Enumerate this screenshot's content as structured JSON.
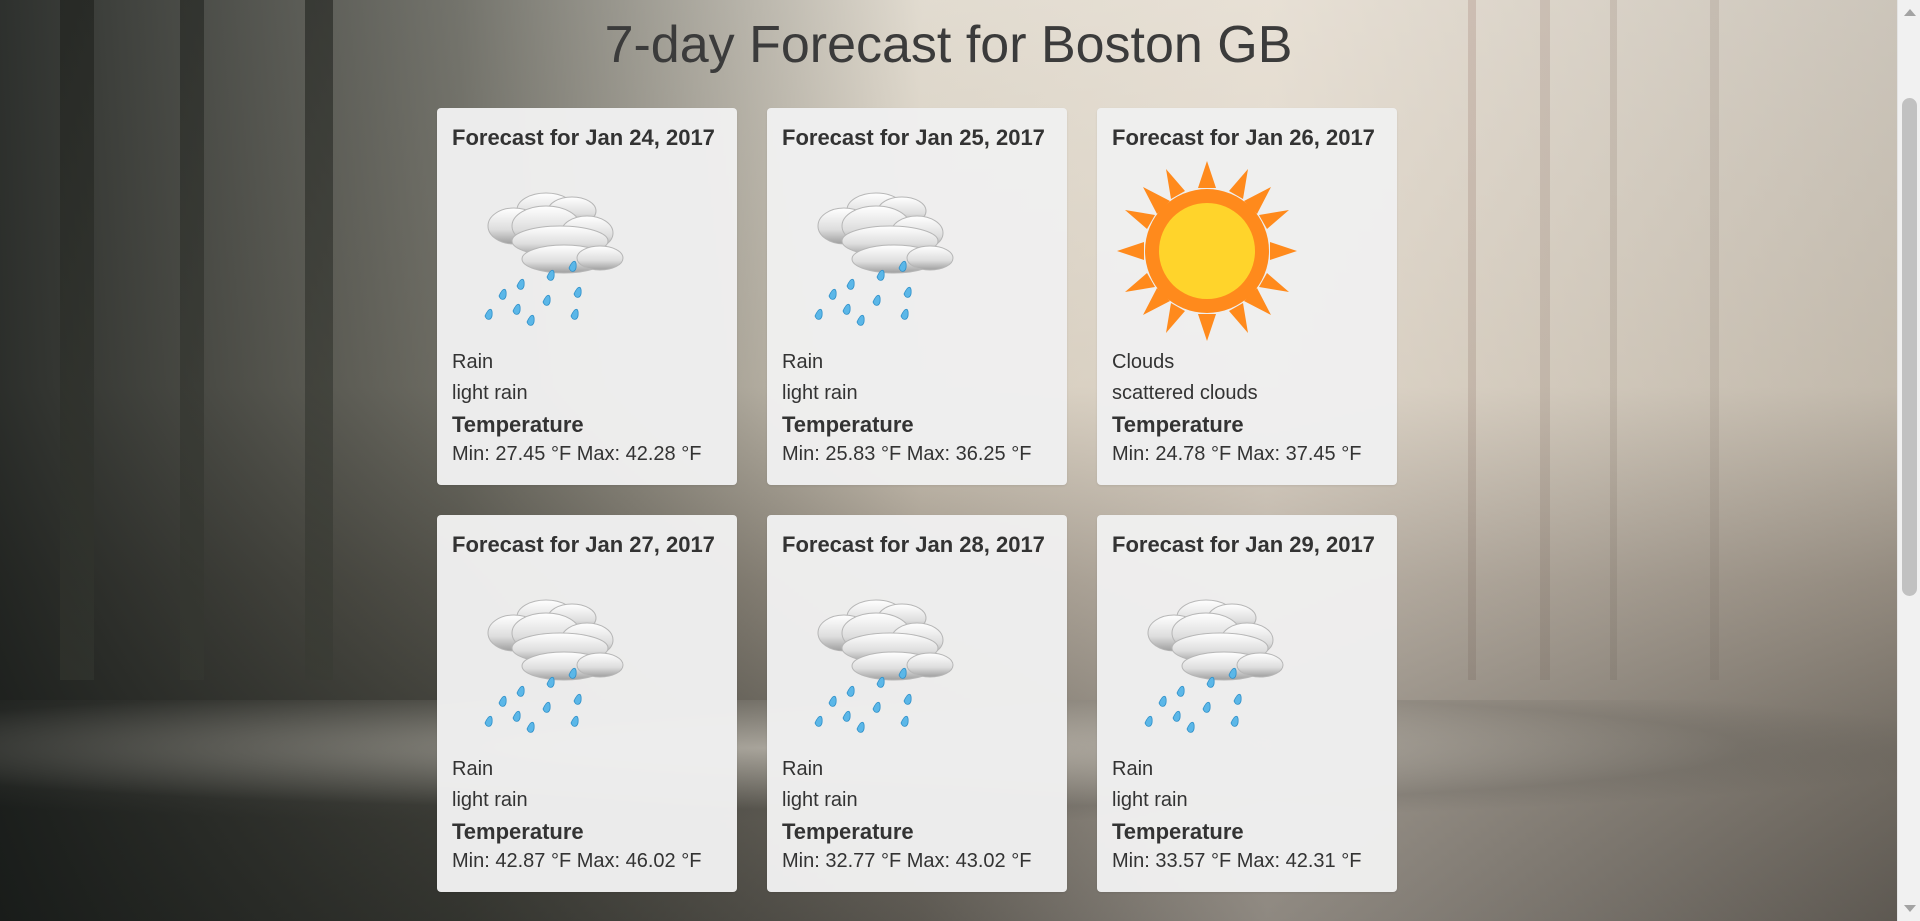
{
  "page": {
    "title": "7-day Forecast for Boston GB"
  },
  "forecast": [
    {
      "date": "Forecast for Jan 24, 2017",
      "icon": "rain-cloud-icon",
      "main": "Rain",
      "description": "light rain",
      "temperature_label": "Temperature",
      "temperature": "Min: 27.45 °F Max: 42.28 °F"
    },
    {
      "date": "Forecast for Jan 25, 2017",
      "icon": "rain-cloud-icon",
      "main": "Rain",
      "description": "light rain",
      "temperature_label": "Temperature",
      "temperature": "Min: 25.83 °F Max: 36.25 °F"
    },
    {
      "date": "Forecast for Jan 26, 2017",
      "icon": "sun-icon",
      "main": "Clouds",
      "description": "scattered clouds",
      "temperature_label": "Temperature",
      "temperature": "Min: 24.78 °F Max: 37.45 °F"
    },
    {
      "date": "Forecast for Jan 27, 2017",
      "icon": "rain-cloud-icon",
      "main": "Rain",
      "description": "light rain",
      "temperature_label": "Temperature",
      "temperature": "Min: 42.87 °F Max: 46.02 °F"
    },
    {
      "date": "Forecast for Jan 28, 2017",
      "icon": "rain-cloud-icon",
      "main": "Rain",
      "description": "light rain",
      "temperature_label": "Temperature",
      "temperature": "Min: 32.77 °F Max: 43.02 °F"
    },
    {
      "date": "Forecast for Jan 29, 2017",
      "icon": "rain-cloud-icon",
      "main": "Rain",
      "description": "light rain",
      "temperature_label": "Temperature",
      "temperature": "Min: 33.57 °F Max: 42.31 °F"
    }
  ],
  "colors": {
    "card_background": "#efefef",
    "title_text": "#3b3b3b",
    "body_text": "#333333",
    "rain_drop": "#5bb7e8",
    "sun_core": "#ffd42b",
    "sun_rays": "#ff8a1c",
    "cloud_light": "#f7f7f7",
    "cloud_shadow": "#9f9f9f"
  }
}
